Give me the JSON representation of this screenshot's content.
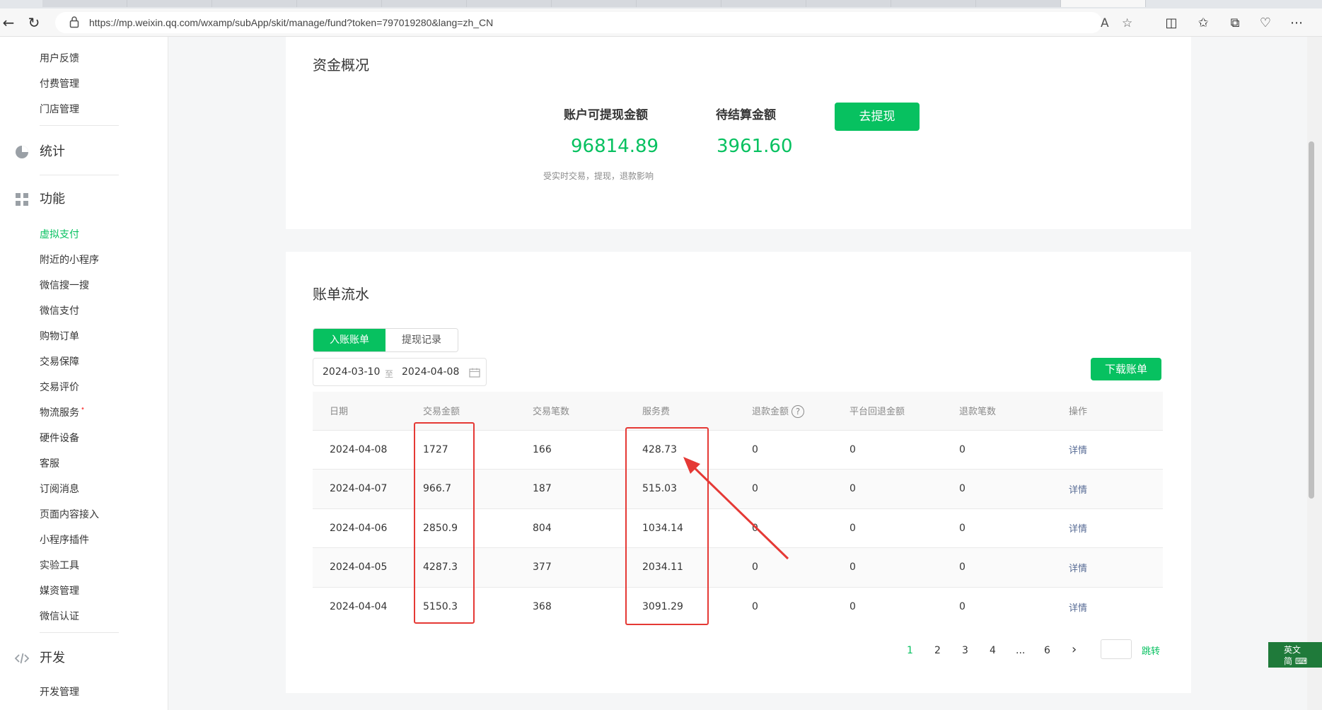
{
  "browser": {
    "url": "https://mp.weixin.qq.com/wxamp/subApp/skit/manage/fund?token=797019280&lang=zh_CN",
    "read_aloud_label": "A"
  },
  "sidebar": {
    "top_items": [
      "用户反馈",
      "付费管理",
      "门店管理"
    ],
    "stats_group": "统计",
    "function_group": "功能",
    "function_items": [
      {
        "label": "虚拟支付",
        "active": true
      },
      {
        "label": "附近的小程序"
      },
      {
        "label": "微信搜一搜"
      },
      {
        "label": "微信支付"
      },
      {
        "label": "购物订单"
      },
      {
        "label": "交易保障"
      },
      {
        "label": "交易评价"
      },
      {
        "label": "物流服务",
        "dot": "•"
      },
      {
        "label": "硬件设备"
      },
      {
        "label": "客服"
      },
      {
        "label": "订阅消息"
      },
      {
        "label": "页面内容接入"
      },
      {
        "label": "小程序插件"
      },
      {
        "label": "实验工具"
      },
      {
        "label": "媒资管理"
      },
      {
        "label": "微信认证"
      }
    ],
    "dev_group": "开发",
    "dev_items": [
      "开发管理"
    ]
  },
  "fund": {
    "title": "资金概况",
    "withdrawable_label": "账户可提现金额",
    "withdrawable_value": "96814.89",
    "withdrawable_note": "受实时交易，提现，退款影响",
    "pending_label": "待结算金额",
    "pending_value": "3961.60",
    "withdraw_button": "去提现"
  },
  "bills": {
    "title": "账单流水",
    "tabs": [
      "入账账单",
      "提现记录"
    ],
    "date_start": "2024-03-10",
    "date_sep": "至",
    "date_end": "2024-04-08",
    "download_button": "下载账单",
    "columns": [
      "日期",
      "交易金额",
      "交易笔数",
      "服务费",
      "退款金额",
      "平台回退金额",
      "退款笔数",
      "操作"
    ],
    "help_mark": "?",
    "rows": [
      [
        "2024-04-08",
        "1727",
        "166",
        "428.73",
        "0",
        "0",
        "0",
        "详情"
      ],
      [
        "2024-04-07",
        "966.7",
        "187",
        "515.03",
        "0",
        "0",
        "0",
        "详情"
      ],
      [
        "2024-04-06",
        "2850.9",
        "804",
        "1034.14",
        "0",
        "0",
        "0",
        "详情"
      ],
      [
        "2024-04-05",
        "4287.3",
        "377",
        "2034.11",
        "0",
        "0",
        "0",
        "详情"
      ],
      [
        "2024-04-04",
        "5150.3",
        "368",
        "3091.29",
        "0",
        "0",
        "0",
        "详情"
      ]
    ],
    "pagination": {
      "pages": [
        "1",
        "2",
        "3",
        "4",
        "...",
        "6"
      ],
      "current": "1",
      "next": "›",
      "jump_label": "跳转"
    }
  },
  "ime": {
    "line1": "英文",
    "line2": "简 ⌨"
  },
  "colors": {
    "accent": "#07c160",
    "annotation": "#e53935",
    "link": "#576b95"
  }
}
